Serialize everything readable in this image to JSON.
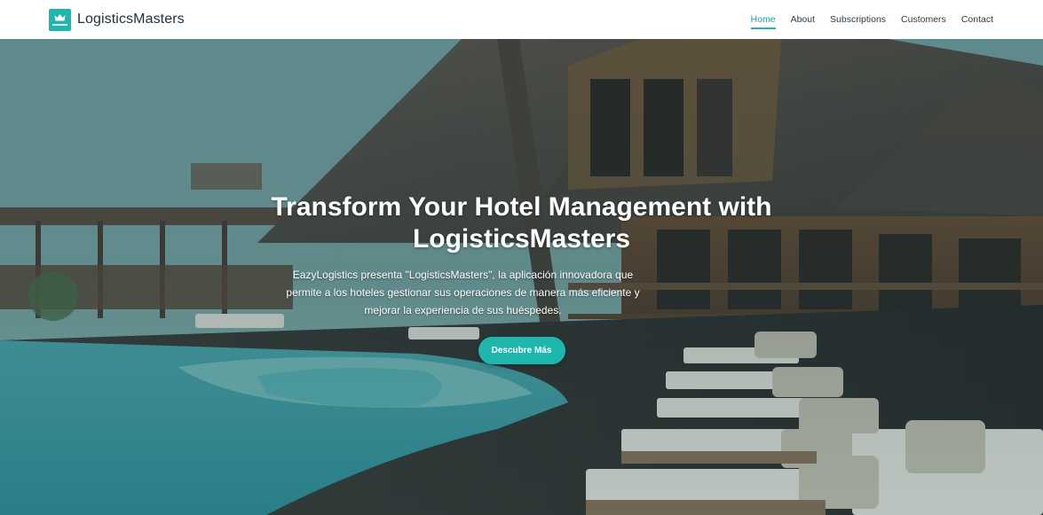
{
  "brand": {
    "name": "LogisticsMasters",
    "logo_icon": "crown-icon",
    "accent_color": "#1fb6ae"
  },
  "nav": {
    "items": [
      {
        "label": "Home",
        "active": true
      },
      {
        "label": "About",
        "active": false
      },
      {
        "label": "Subscriptions",
        "active": false
      },
      {
        "label": "Customers",
        "active": false
      },
      {
        "label": "Contact",
        "active": false
      }
    ]
  },
  "hero": {
    "title": "Transform Your Hotel Management with LogisticsMasters",
    "description": "EazyLogistics presenta \"LogisticsMasters\", la aplicación innovadora que permite a los hoteles gestionar sus operaciones de manera más eficiente y mejorar la experiencia de sus huéspedes.",
    "cta_label": "Descubre Más",
    "background": "hotel-pool-resort-photo"
  }
}
